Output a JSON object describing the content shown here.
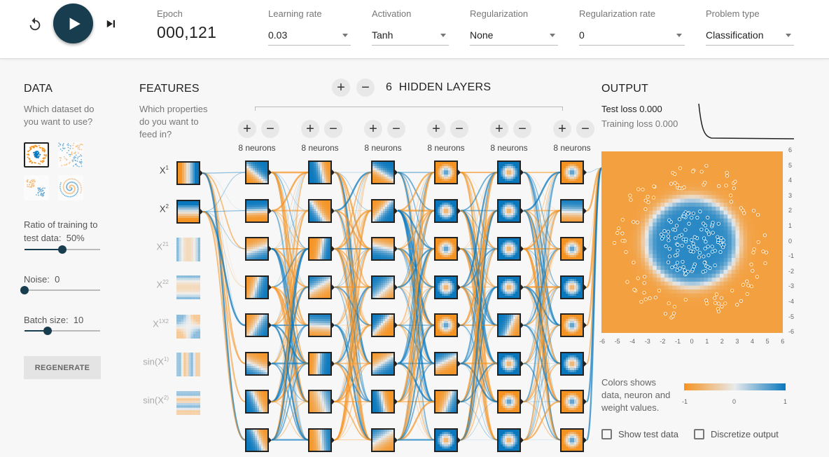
{
  "controls": {
    "reset_icon": "reset-icon",
    "play_icon": "play-icon",
    "step_icon": "step-forward-icon",
    "epoch_label": "Epoch",
    "epoch_value": "000,121",
    "learning_rate_label": "Learning rate",
    "learning_rate_value": "0.03",
    "activation_label": "Activation",
    "activation_value": "Tanh",
    "regularization_label": "Regularization",
    "regularization_value": "None",
    "regularization_rate_label": "Regularization rate",
    "regularization_rate_value": "0",
    "problem_type_label": "Problem type",
    "problem_type_value": "Classification",
    "accent_color": "#183d4e"
  },
  "data_panel": {
    "title": "DATA",
    "question": "Which dataset do you want to use?",
    "datasets": [
      "circle",
      "xor",
      "gaussian",
      "spiral"
    ],
    "selected_dataset": "circle",
    "ratio_label": "Ratio of training to test data:",
    "ratio_value": "50%",
    "ratio_level": 0.5,
    "noise_label": "Noise:",
    "noise_value": "0",
    "noise_level": 0,
    "batch_label": "Batch size:",
    "batch_value": "10",
    "batch_level": 0.31,
    "regenerate_label": "REGENERATE"
  },
  "features_panel": {
    "title": "FEATURES",
    "question": "Which properties do you want to feed in?",
    "features": [
      {
        "base": "X",
        "sup": "",
        "sub": "1",
        "active": true
      },
      {
        "base": "X",
        "sup": "",
        "sub": "2",
        "active": true
      },
      {
        "base": "X",
        "sup": "2",
        "sub": "1",
        "active": false
      },
      {
        "base": "X",
        "sup": "2",
        "sub": "2",
        "active": false
      },
      {
        "base": "X",
        "sup": "",
        "sub": "1X2",
        "active": false
      },
      {
        "base": "sin(X",
        "sup": "",
        "sub": "1)",
        "active": false
      },
      {
        "base": "sin(X",
        "sup": "",
        "sub": "2)",
        "active": false
      }
    ]
  },
  "network": {
    "layer_count": "6",
    "layers_label": "HIDDEN LAYERS",
    "add_icon": "plus-icon",
    "remove_icon": "minus-icon",
    "layers": [
      {
        "neurons_label": "8 neurons"
      },
      {
        "neurons_label": "8 neurons"
      },
      {
        "neurons_label": "8 neurons"
      },
      {
        "neurons_label": "8 neurons"
      },
      {
        "neurons_label": "8 neurons"
      },
      {
        "neurons_label": "8 neurons"
      }
    ]
  },
  "output": {
    "title": "OUTPUT",
    "test_loss_label": "Test loss",
    "test_loss_value": "0.000",
    "training_loss_label": "Training loss",
    "training_loss_value": "0.000",
    "x_ticks": [
      "-6",
      "-5",
      "-4",
      "-3",
      "-2",
      "-1",
      "0",
      "1",
      "2",
      "3",
      "4",
      "5",
      "6"
    ],
    "y_ticks": [
      "6",
      "5",
      "4",
      "3",
      "2",
      "1",
      "0",
      "-1",
      "-2",
      "-3",
      "-4",
      "-5",
      "-6"
    ],
    "legend_text": "Colors shows data, neuron and weight values.",
    "legend_ticks": [
      "-1",
      "0",
      "1"
    ],
    "show_test_label": "Show test data",
    "discretize_label": "Discretize output",
    "orange_color": "#f59322",
    "blue_color": "#0877bd"
  }
}
